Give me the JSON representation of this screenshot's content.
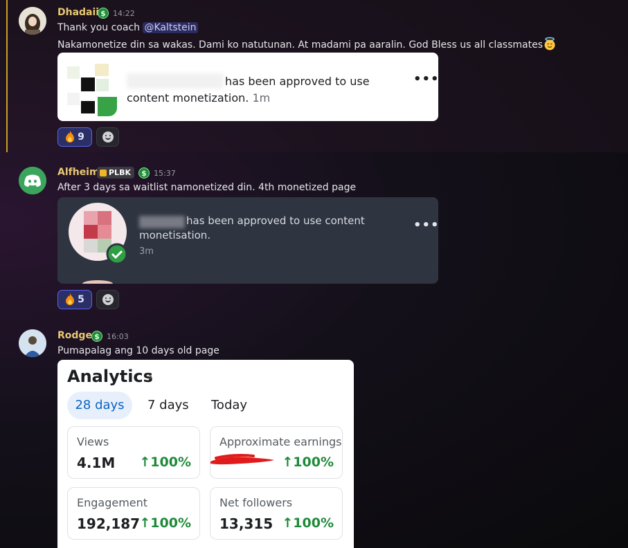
{
  "messages": [
    {
      "username": "Dhadaii",
      "username_color": "#e8c874",
      "timestamp": "14:22",
      "badge_icon": "dollar-icon",
      "lines": [
        "Thank you coach ",
        "Nakamonetize din sa wakas. Dami ko natutunan. At madami pa aaralin. God Bless us all classmates"
      ],
      "mention": "@Kaltstein",
      "emoji": "innocent-face-icon",
      "card": {
        "text_line1": "has been approved to use",
        "text_line2": "content monetization.",
        "age": "1m"
      },
      "reaction": {
        "emoji": "fire-icon",
        "count": "9"
      }
    },
    {
      "username": "Alfheim",
      "username_color": "#e8c874",
      "timestamp": "15:37",
      "guild_tag": "PLBK",
      "badge_icon": "dollar-icon",
      "line": "After 3 days sa waitlist namonetized din. 4th monetized page",
      "card": {
        "text_line1": "has been approved to use content",
        "text_line2": "monetisation.",
        "age": "3m"
      },
      "reaction": {
        "emoji": "fire-icon",
        "count": "5"
      }
    },
    {
      "username": "Rodge",
      "username_color": "#e8c874",
      "timestamp": "16:03",
      "badge_icon": "dollar-icon",
      "line": "Pumapalag ang 10 days old page",
      "analytics": {
        "title": "Analytics",
        "tabs": [
          "28 days",
          "7 days",
          "Today"
        ],
        "active_tab": "28 days",
        "stats": [
          {
            "label": "Views",
            "value": "4.1M",
            "change": "↑100%"
          },
          {
            "label": "Approximate earnings",
            "value": "",
            "change": "↑100%"
          },
          {
            "label": "Engagement",
            "value": "192,187",
            "change": "↑100%"
          },
          {
            "label": "Net followers",
            "value": "13,315",
            "change": "↑100%"
          }
        ]
      }
    }
  ],
  "colors": {
    "accent": "#5865f2",
    "positive": "#1e8a3a",
    "tab_active": "#0a62c4",
    "redaction": "#e01b1b"
  }
}
